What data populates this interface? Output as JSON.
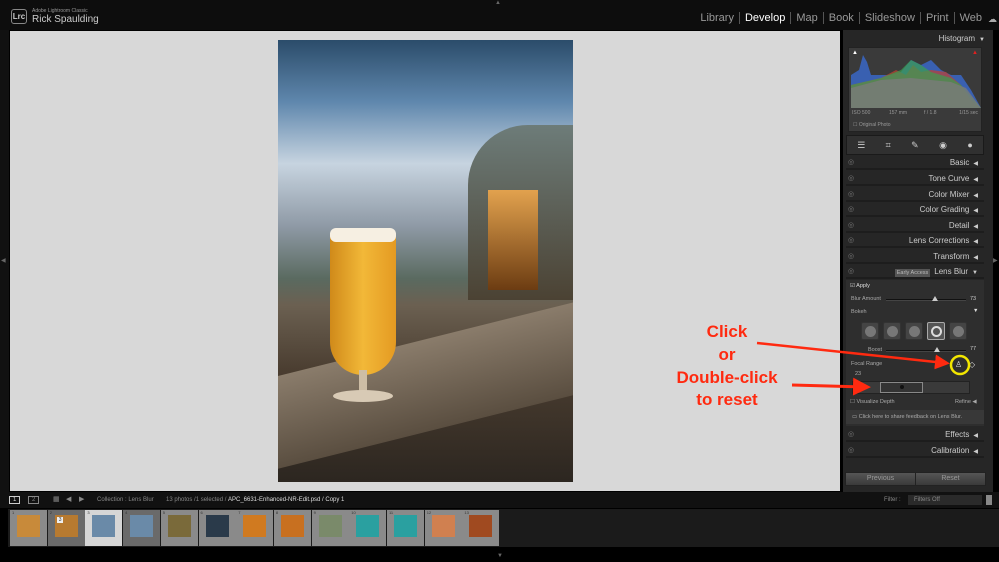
{
  "app": {
    "name": "Adobe Lightroom Classic",
    "logo": "Lrc",
    "user": "Rick Spaulding"
  },
  "modules": [
    "Library",
    "Develop",
    "Map",
    "Book",
    "Slideshow",
    "Print",
    "Web"
  ],
  "active_module": "Develop",
  "histogram": {
    "title": "Histogram",
    "iso": "ISO 500",
    "focal": "157 mm",
    "aperture": "f / 1.8",
    "shutter": "1/15 sec",
    "original_photo": "Original Photo"
  },
  "panels": [
    "Basic",
    "Tone Curve",
    "Color Mixer",
    "Color Grading",
    "Detail",
    "Lens Corrections",
    "Transform"
  ],
  "lens_blur": {
    "title": "Lens Blur",
    "badge": "Early Access",
    "apply": "Apply",
    "blur_amount_label": "Blur Amount",
    "blur_amount": 73,
    "bokeh_label": "Bokeh",
    "boost_label": "Boost",
    "boost": 77,
    "focal_range_label": "Focal Range",
    "focal_range_min": 23,
    "visualize_depth": "Visualize Depth",
    "refine": "Refine",
    "feedback": "Click here to share feedback on Lens Blur."
  },
  "panels_after": [
    "Effects",
    "Calibration"
  ],
  "buttons": {
    "previous": "Previous",
    "reset": "Reset"
  },
  "filmstrip_bar": {
    "page1": "1",
    "page2": "2",
    "collection": "Collection : Lens Blur",
    "count": "13 photos /1 selected /",
    "filename": "APC_6631-Enhanced-NR-Edit.psd / Copy 1",
    "filter_label": "Filter :",
    "filter_value": "Filters Off"
  },
  "filmstrip": {
    "selected_index": 3,
    "stack_badge": "3",
    "thumbs": [
      "#c88a3a",
      "#b77a30",
      "#6a8aa8",
      "#6a8aa8",
      "#7a6a3a",
      "#2a3a4a",
      "#d07a20",
      "#c87020",
      "#7a8a6a",
      "#2aa0a0",
      "#2aa0a0",
      "#d08050",
      "#a04a20"
    ]
  },
  "annotation": {
    "lines": [
      "Click",
      "or",
      "Double-click",
      "to reset"
    ],
    "color": "#ff2a10",
    "highlight": "#f2e600"
  }
}
